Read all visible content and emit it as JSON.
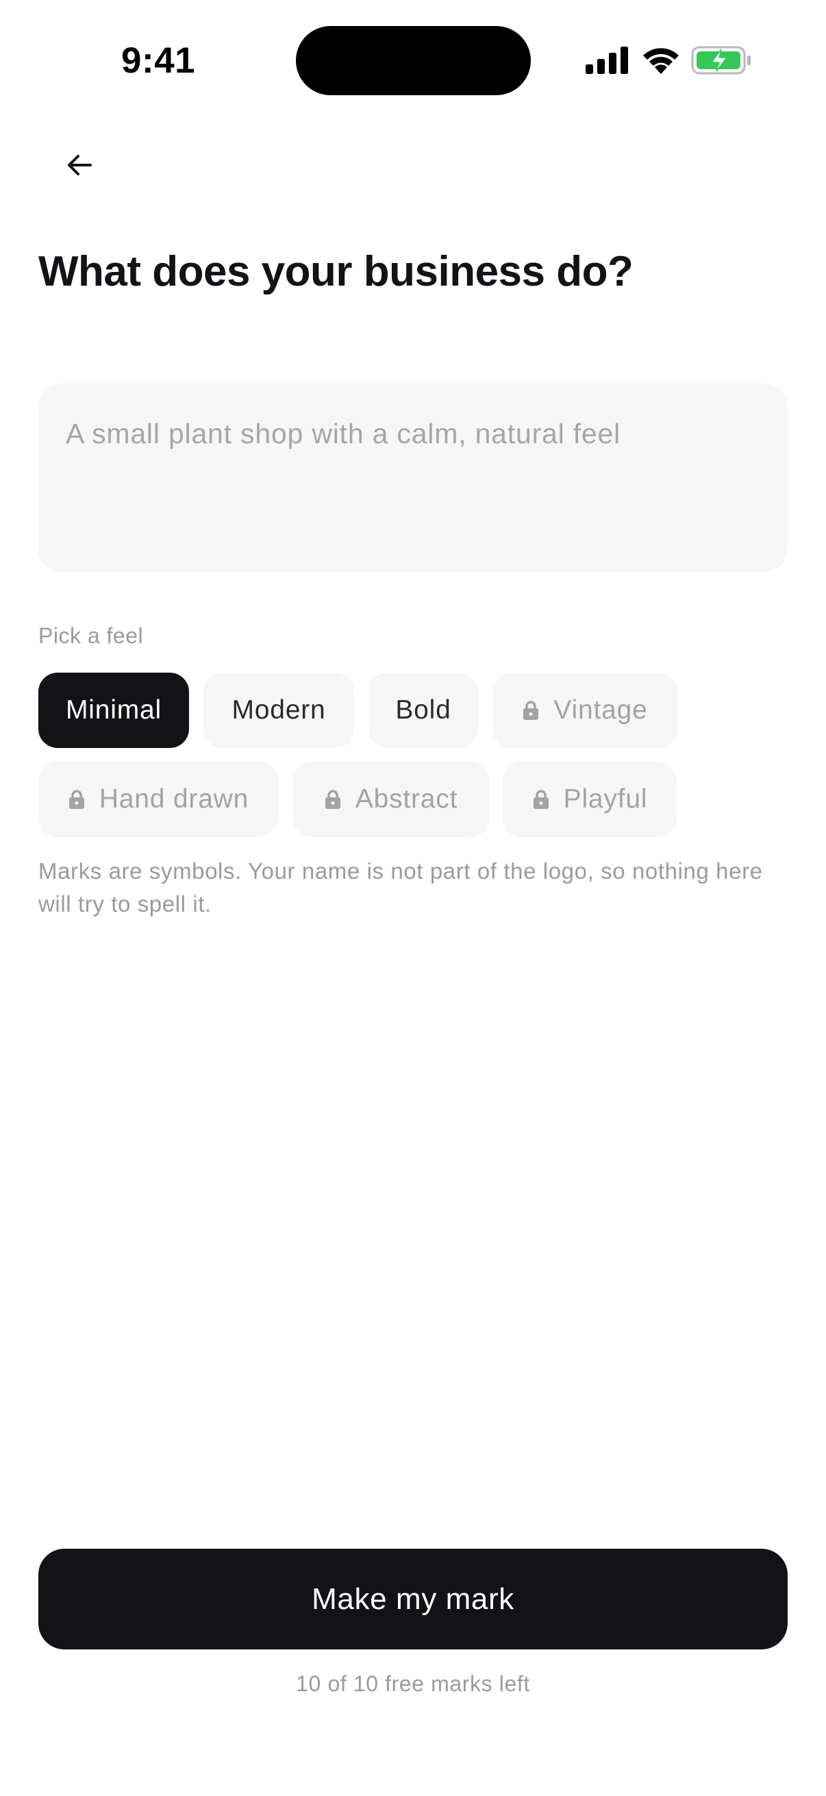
{
  "status_bar": {
    "time": "9:41"
  },
  "page": {
    "title": "What does your business do?"
  },
  "description": {
    "value": "",
    "placeholder": "A small plant shop with a calm, natural feel"
  },
  "feel": {
    "label": "Pick a feel",
    "chips": [
      {
        "label": "Minimal",
        "state": "selected"
      },
      {
        "label": "Modern",
        "state": "available"
      },
      {
        "label": "Bold",
        "state": "available"
      },
      {
        "label": "Vintage",
        "state": "locked"
      },
      {
        "label": "Hand drawn",
        "state": "locked"
      },
      {
        "label": "Abstract",
        "state": "locked"
      },
      {
        "label": "Playful",
        "state": "locked"
      }
    ]
  },
  "helper": {
    "text": "Marks are symbols. Your name is not part of the logo, so nothing here will try to spell it."
  },
  "cta": {
    "label": "Make my mark"
  },
  "quota": {
    "text": "10 of 10 free marks left"
  },
  "colors": {
    "primary": "#131317",
    "chip_bg": "#f6f6f6",
    "muted_text": "#9a9a9f",
    "battery_green": "#34c759"
  },
  "icons": {
    "back": "arrow-left-icon",
    "lock": "lock-icon",
    "signal": "cellular-signal-icon",
    "wifi": "wifi-icon",
    "battery": "battery-charging-icon"
  }
}
